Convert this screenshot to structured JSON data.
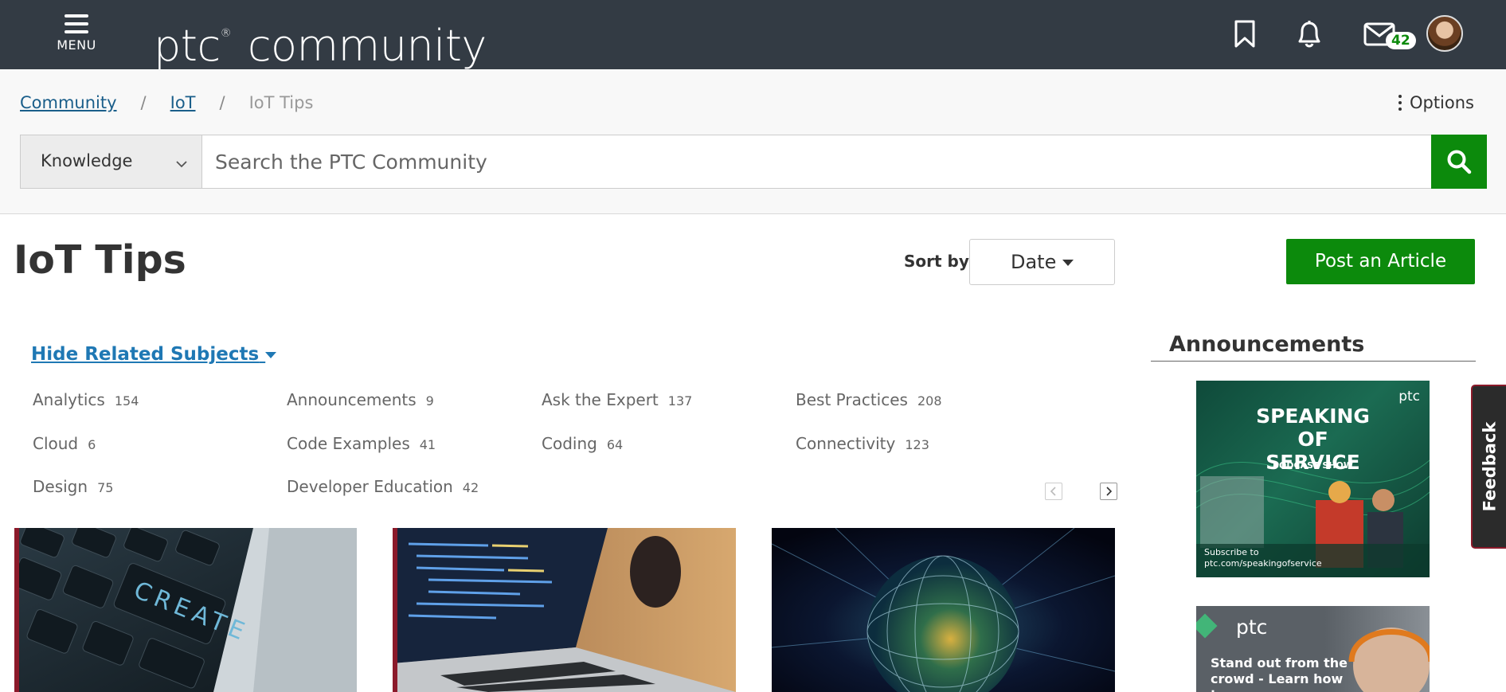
{
  "header": {
    "menu_label": "MENU",
    "logo_brand": "ptc",
    "logo_mark": "®",
    "logo_text": "community",
    "messages_count": "42"
  },
  "breadcrumb": {
    "items": [
      "Community",
      "IoT"
    ],
    "separator": "/",
    "current": "IoT Tips"
  },
  "options_label": "Options",
  "search": {
    "scope": "Knowledge",
    "placeholder": "Search the PTC Community"
  },
  "page": {
    "title": "IoT Tips",
    "sort_label": "Sort by:",
    "sort_value": "Date",
    "post_button": "Post an Article"
  },
  "related": {
    "toggle_label": "Hide Related Subjects",
    "subjects": [
      {
        "label": "Analytics",
        "count": "154"
      },
      {
        "label": "Announcements",
        "count": "9"
      },
      {
        "label": "Ask the Expert",
        "count": "137"
      },
      {
        "label": "Best Practices",
        "count": "208"
      },
      {
        "label": "Cloud",
        "count": "6"
      },
      {
        "label": "Code Examples",
        "count": "41"
      },
      {
        "label": "Coding",
        "count": "64"
      },
      {
        "label": "Connectivity",
        "count": "123"
      },
      {
        "label": "Design",
        "count": "75"
      },
      {
        "label": "Developer Education",
        "count": "42"
      }
    ]
  },
  "sidebar": {
    "announcements_title": "Announcements",
    "banner1": {
      "brand": "ptc",
      "title": "SPEAKING\nOF\nSERVICE",
      "subtitle": "PODCAST SHOW",
      "cta": "Subscribe to\nptc.com/speakingofservice"
    },
    "banner2": {
      "brand": "ptc",
      "text": "Stand out from the crowd - Learn how to"
    }
  },
  "feedback_label": "Feedback",
  "colors": {
    "topbar": "#333b44",
    "accent_green": "#0c8a0c",
    "link_blue": "#1f78b4",
    "stripe": "#8b1a2a"
  }
}
